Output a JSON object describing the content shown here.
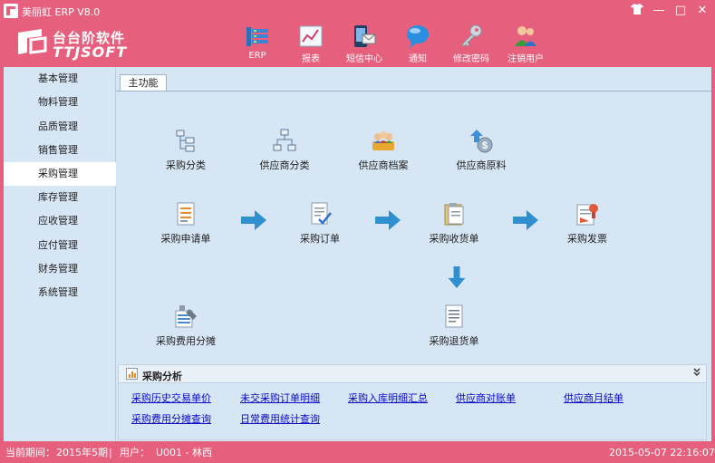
{
  "window": {
    "title": "美丽虹 ERP V8.0",
    "shirt_icon": "shirt-icon",
    "minimize": "—",
    "maximize": "□",
    "close": "✕"
  },
  "brand": {
    "name_cn": "台台阶软件",
    "name_en": "TTJSOFT"
  },
  "toolbar": [
    {
      "label": "ERP",
      "icon": "erp-database-icon"
    },
    {
      "label": "报表",
      "icon": "report-chart-icon"
    },
    {
      "label": "短信中心",
      "icon": "sms-center-icon"
    },
    {
      "label": "通知",
      "icon": "notification-bubble-icon"
    },
    {
      "label": "修改密码",
      "icon": "key-icon"
    },
    {
      "label": "注销用户",
      "icon": "users-logout-icon"
    }
  ],
  "sidebar": {
    "items": [
      {
        "label": "基本管理"
      },
      {
        "label": "物料管理"
      },
      {
        "label": "品质管理"
      },
      {
        "label": "销售管理"
      },
      {
        "label": "采购管理",
        "active": true
      },
      {
        "label": "库存管理"
      },
      {
        "label": "应收管理"
      },
      {
        "label": "应付管理"
      },
      {
        "label": "财务管理"
      },
      {
        "label": "系统管理"
      }
    ]
  },
  "main": {
    "tab_label": "主功能",
    "functions": {
      "purchase_category": "采购分类",
      "supplier_category": "供应商分类",
      "supplier_archive": "供应商档案",
      "supplier_material": "供应商原料",
      "purchase_request": "采购申请单",
      "purchase_order": "采购订单",
      "purchase_receipt": "采购收货单",
      "purchase_invoice": "采购发票",
      "purchase_cost_allocation": "采购费用分摊",
      "purchase_return": "采购退货单"
    },
    "analysis": {
      "title": "采购分析",
      "links": [
        "采购历史交易单价",
        "未交采购订单明细",
        "采购入库明细汇总",
        "供应商对账单",
        "供应商月结单",
        "采购费用分摊查询",
        "日常费用统计查询"
      ]
    }
  },
  "status": {
    "period_label": "当前期间：",
    "period_value": "2015年5期",
    "sep": "|",
    "user_label": "用户：",
    "user_value": "U001 - 林西",
    "datetime": "2015-05-07 22:16:07"
  },
  "colors": {
    "brand_pink": "#e6607e",
    "panel_blue": "#d6e6f5",
    "link_blue": "#0a0ac8",
    "flow_arrow": "#2f8fd0"
  }
}
